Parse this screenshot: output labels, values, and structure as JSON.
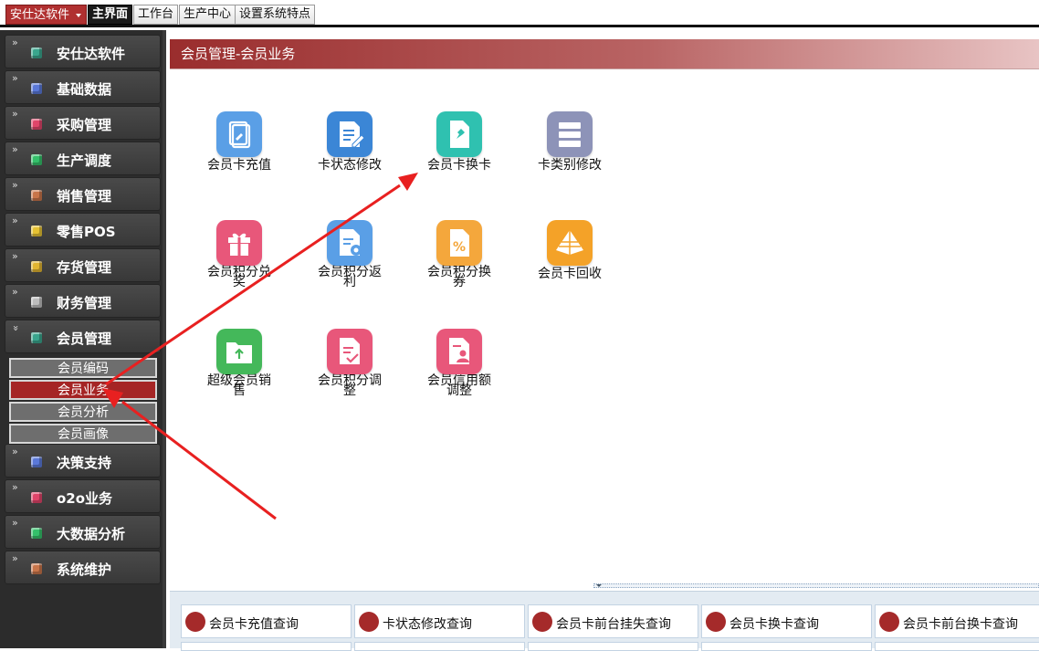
{
  "topbar": {
    "brand": "安仕达软件",
    "tabs": [
      {
        "label": "主界面",
        "active": true
      },
      {
        "label": "工作台",
        "active": false
      },
      {
        "label": "生产中心",
        "active": false
      },
      {
        "label": "设置系统特点",
        "active": false
      }
    ]
  },
  "sidebar": {
    "items": [
      {
        "label": "安仕达软件",
        "icon": "cube-teal-icon",
        "color": "#3aa58d"
      },
      {
        "label": "基础数据",
        "icon": "cube-blue-icon",
        "color": "#5a78d8"
      },
      {
        "label": "采购管理",
        "icon": "cube-pink-icon",
        "color": "#e0456a"
      },
      {
        "label": "生产调度",
        "icon": "cube-green-icon",
        "color": "#34c06a"
      },
      {
        "label": "销售管理",
        "icon": "cube-brown-icon",
        "color": "#c8754a"
      },
      {
        "label": "零售POS",
        "icon": "cube-yellow-icon",
        "color": "#e6c233"
      },
      {
        "label": "存货管理",
        "icon": "cube-gold-icon",
        "color": "#e2b531"
      },
      {
        "label": "财务管理",
        "icon": "cube-gray-icon",
        "color": "#bdbdbd"
      },
      {
        "label": "会员管理",
        "icon": "cube-teal-icon",
        "color": "#3aa58d",
        "expanded": true
      },
      {
        "label": "决策支持",
        "icon": "cube-blue-icon",
        "color": "#5a78d8"
      },
      {
        "label": "o2o业务",
        "icon": "cube-pink-icon",
        "color": "#e0456a"
      },
      {
        "label": "大数据分析",
        "icon": "cube-green-icon",
        "color": "#34c06a"
      },
      {
        "label": "系统维护",
        "icon": "cube-brown-icon",
        "color": "#c8754a"
      }
    ],
    "subitems": [
      {
        "label": "会员编码",
        "active": false
      },
      {
        "label": "会员业务",
        "active": true
      },
      {
        "label": "会员分析",
        "active": false
      },
      {
        "label": "会员画像",
        "active": false
      }
    ]
  },
  "main": {
    "title": "会员管理-会员业务",
    "tiles": [
      {
        "label": "会员卡充值",
        "icon": "card-recharge-icon",
        "color": "#5a9fe6"
      },
      {
        "label": "卡状态修改",
        "icon": "document-edit-icon",
        "color": "#3b86d6"
      },
      {
        "label": "会员卡换卡",
        "icon": "pin-document-icon",
        "color": "#2fc1b0"
      },
      {
        "label": "卡类别修改",
        "icon": "server-list-icon",
        "color": "#8d93b8"
      },
      {
        "label": "会员积分兑奖",
        "icon": "gift-icon",
        "color": "#e8577a"
      },
      {
        "label": "会员积分返利",
        "icon": "document-gear-icon",
        "color": "#5a9fe6"
      },
      {
        "label": "会员积分换券",
        "icon": "percent-coupon-icon",
        "color": "#f4a73c"
      },
      {
        "label": "会员卡回收",
        "icon": "pyramid-icon",
        "color": "#f4a228"
      },
      {
        "label": "超级会员销售",
        "icon": "folder-upload-icon",
        "color": "#44b85a"
      },
      {
        "label": "会员积分调整",
        "icon": "document-check-icon",
        "color": "#e8577a"
      },
      {
        "label": "会员信用额调整",
        "icon": "person-document-icon",
        "color": "#e8577a"
      }
    ],
    "queries": [
      {
        "label": "会员卡充值查询",
        "icon": "handshake-icon"
      },
      {
        "label": "卡状态修改查询",
        "icon": "layers-icon"
      },
      {
        "label": "会员卡前台挂失查询",
        "icon": "bar-chart-icon"
      },
      {
        "label": "会员卡换卡查询",
        "icon": "pie-chart-icon"
      },
      {
        "label": "会员卡前台换卡查询",
        "icon": "network-icon"
      }
    ]
  },
  "colors": {
    "accent": "#a52525",
    "sidebar_bg": "#2c2c2c",
    "arrow": "#e82020"
  }
}
